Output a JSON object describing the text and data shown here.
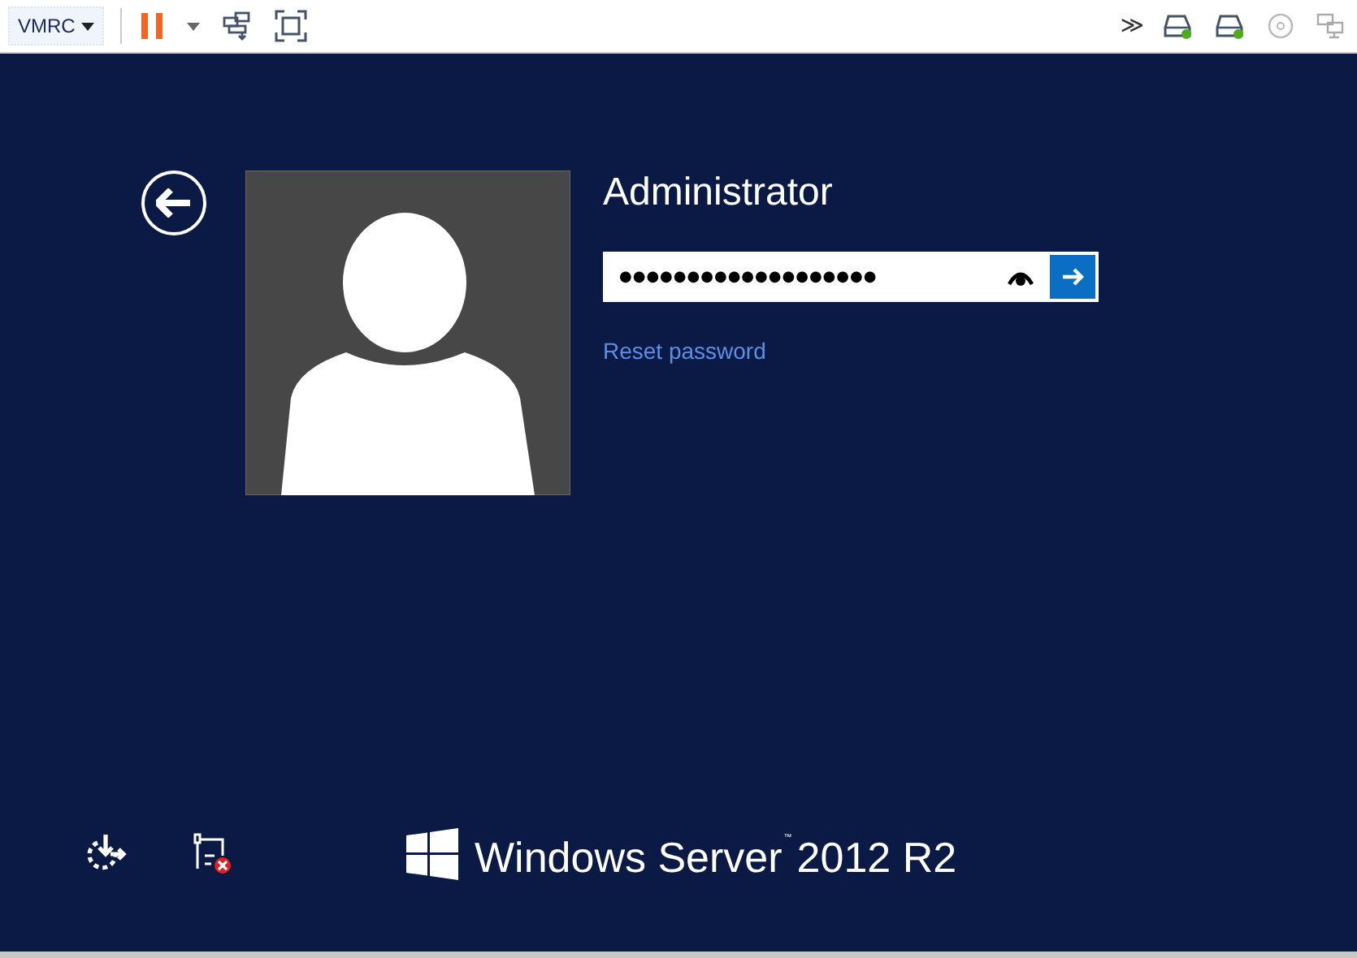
{
  "toolbar": {
    "menu_label": "VMRC",
    "overflow": "≫",
    "drives": [
      {
        "connected": true
      },
      {
        "connected": true
      }
    ],
    "cd_connected": false,
    "network_connected": false
  },
  "login": {
    "user_name": "Administrator",
    "password_mask": "●●●●●●●●●●●●●●●●●●●",
    "reset_link": "Reset password"
  },
  "footer": {
    "network_error": true,
    "brand": "Windows Server",
    "trademark": "™",
    "version": "2012 R2"
  }
}
